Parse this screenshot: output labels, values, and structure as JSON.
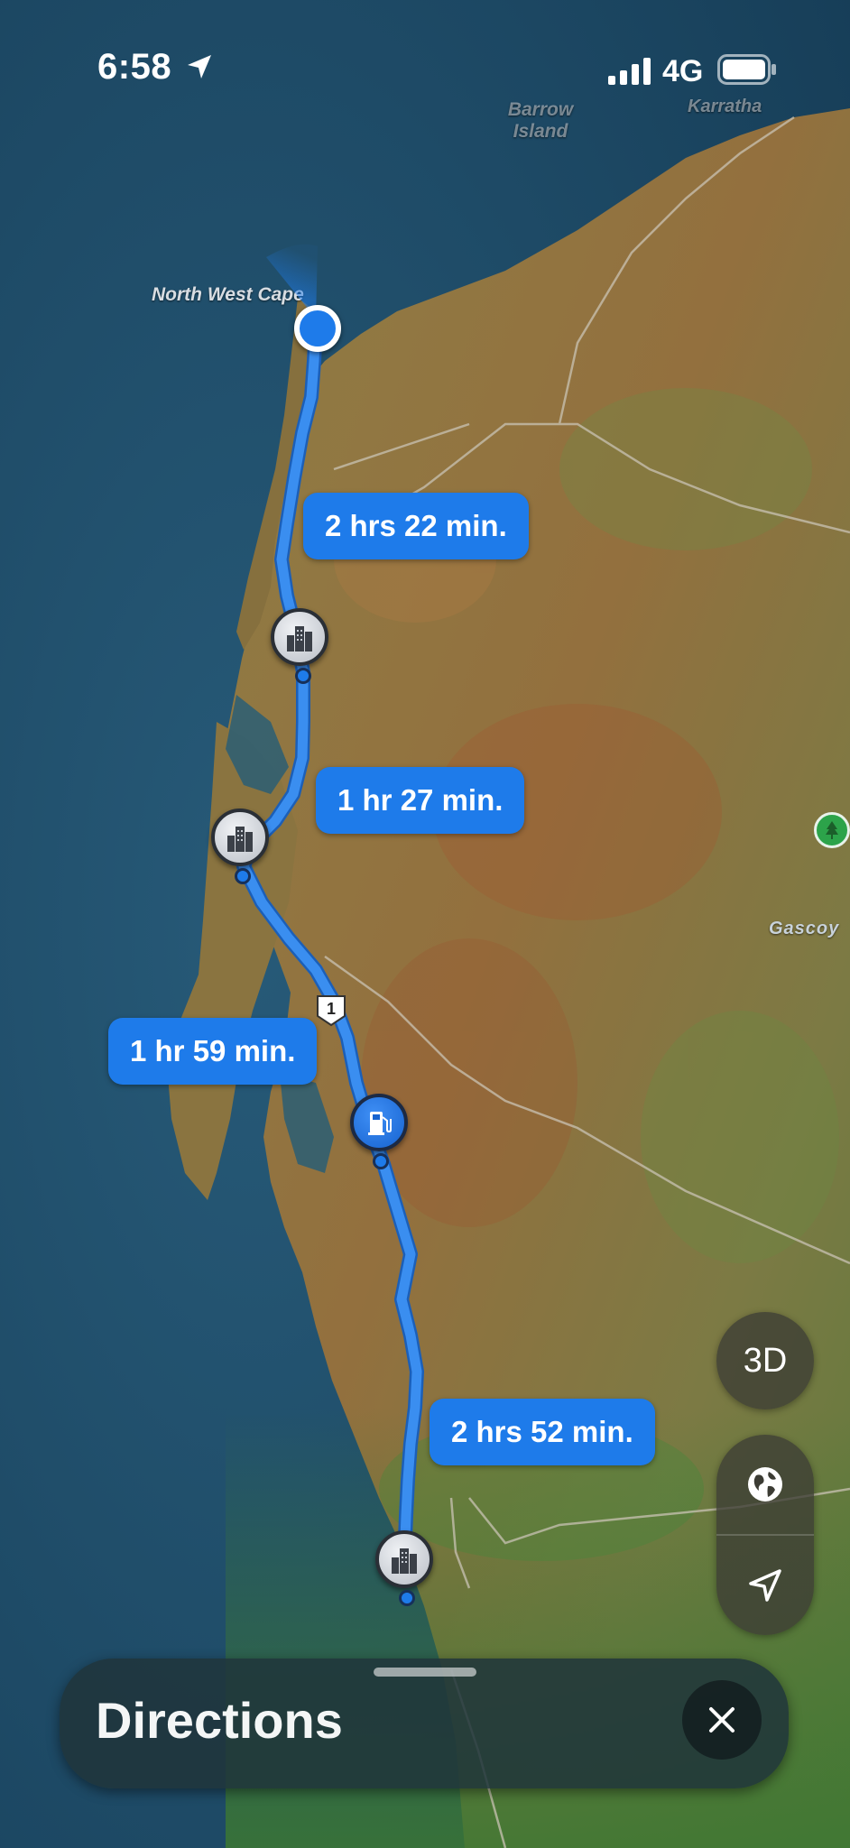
{
  "status_bar": {
    "time": "6:58",
    "network": "4G",
    "icons": [
      "location-arrow-icon",
      "cellular-signal-icon",
      "battery-icon"
    ]
  },
  "map": {
    "place_labels": {
      "north_west_cape": "North West Cape",
      "barrow_island": "Barrow\nIsland",
      "karratha": "Karratha",
      "gascoyne": "Gascoy"
    },
    "route_segments": [
      {
        "eta": "2 hrs 22 min."
      },
      {
        "eta": "1 hr 27 min."
      },
      {
        "eta": "1 hr 59 min."
      },
      {
        "eta": "2 hrs 52 min."
      }
    ],
    "highway_shield": "1",
    "colors": {
      "route": "#3a8ef0",
      "eta_bubble": "#1e7bea",
      "ocean": "#1d4a66",
      "land": "#8a7a48"
    }
  },
  "controls": {
    "three_d_label": "3D",
    "globe_icon": "globe-icon",
    "locate_icon": "location-arrow-icon"
  },
  "sheet": {
    "title": "Directions",
    "close_icon": "close-icon"
  }
}
